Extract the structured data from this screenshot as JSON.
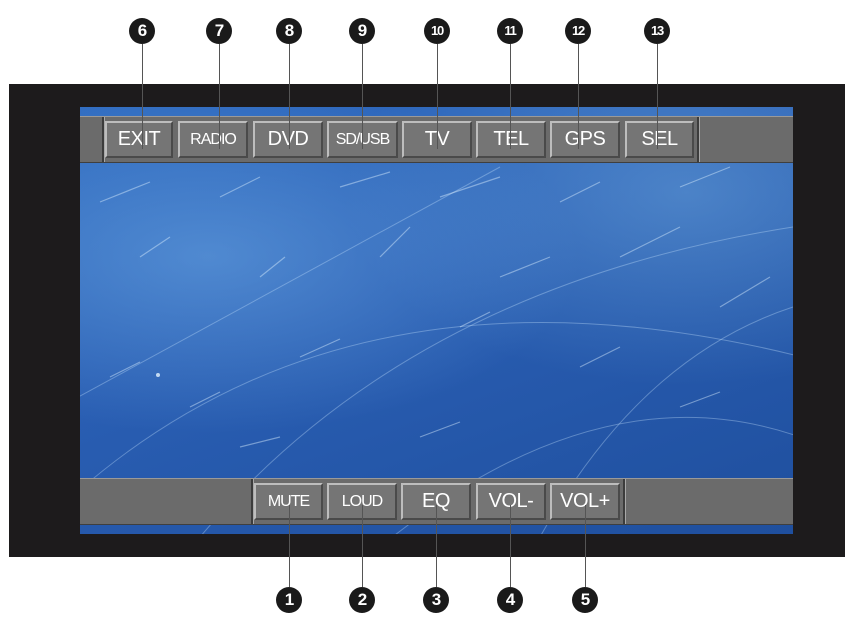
{
  "top_buttons": [
    {
      "label": "EXIT",
      "callout": "6"
    },
    {
      "label": "RADIO",
      "callout": "7"
    },
    {
      "label": "DVD",
      "callout": "8"
    },
    {
      "label": "SD/USB",
      "callout": "9"
    },
    {
      "label": "TV",
      "callout": "10"
    },
    {
      "label": "TEL",
      "callout": "11"
    },
    {
      "label": "GPS",
      "callout": "12"
    },
    {
      "label": "SEL",
      "callout": "13"
    }
  ],
  "bottom_buttons": [
    {
      "label": "MUTE",
      "callout": "1"
    },
    {
      "label": "LOUD",
      "callout": "2"
    },
    {
      "label": "EQ",
      "callout": "3"
    },
    {
      "label": "VOL-",
      "callout": "4"
    },
    {
      "label": "VOL+",
      "callout": "5"
    }
  ],
  "colors": {
    "screen_blue": "#2a5fb4",
    "bar_gray": "#6b6b6b",
    "frame": "#1d1b1c",
    "callout": "#1a1a1a"
  }
}
